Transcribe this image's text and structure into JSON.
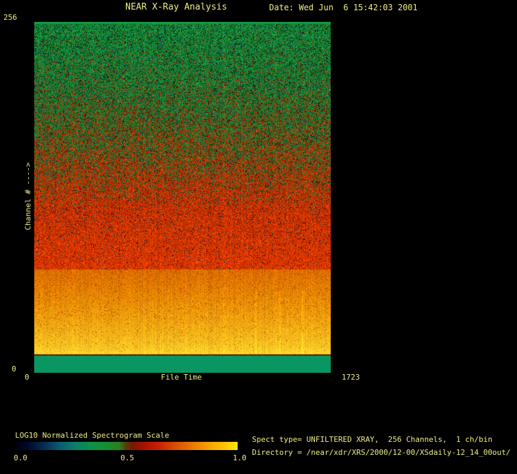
{
  "header": {
    "title": "NEAR X-Ray Analysis",
    "date_label": "Date: Wed Jun  6 15:42:03 2001"
  },
  "axes": {
    "y_max": "256",
    "y_min": "0",
    "y_title": "Channel # ---->",
    "x_min": "0",
    "x_max": "1723",
    "x_title": "File Time"
  },
  "footer": {
    "scale_label": "LOG10 Normalized Spectrogram Scale",
    "scale_tick_left": "0.0",
    "scale_tick_mid": "0.5",
    "scale_tick_right": "1.0",
    "spect_info": "Spect type= UNFILTERED XRAY,  256 Channels,  1 ch/bin",
    "directory_info": "Directory = /near/xdr/XRS/2000/12-00/XSdaily-12_14_00out/"
  },
  "colors": {
    "text": "#f1ee85",
    "background": "#000000",
    "bottom_green": "#0a9663"
  },
  "chart_data": {
    "type": "heatmap",
    "title": "NEAR X-Ray Analysis",
    "xlabel": "File Time",
    "ylabel": "Channel # ---->",
    "x_range": [
      0,
      1723
    ],
    "y_range": [
      0,
      256
    ],
    "x_ticks": [
      "0",
      "1723"
    ],
    "y_ticks": [
      "0",
      "256"
    ],
    "grid": false,
    "colorbar": {
      "label": "LOG10 Normalized Spectrogram Scale",
      "range": [
        0.0,
        1.0
      ],
      "ticks": [
        "0.0",
        "0.5",
        "1.0"
      ],
      "stops": [
        {
          "pos": 0.0,
          "color": "#00000d"
        },
        {
          "pos": 0.06,
          "color": "#000a28"
        },
        {
          "pos": 0.13,
          "color": "#062c52"
        },
        {
          "pos": 0.2,
          "color": "#0b5a74"
        },
        {
          "pos": 0.27,
          "color": "#0c7e6a"
        },
        {
          "pos": 0.34,
          "color": "#0c9148"
        },
        {
          "pos": 0.41,
          "color": "#149032"
        },
        {
          "pos": 0.47,
          "color": "#2e7c1a"
        },
        {
          "pos": 0.5,
          "color": "#553c08"
        },
        {
          "pos": 0.53,
          "color": "#7c1404"
        },
        {
          "pos": 0.58,
          "color": "#a81200"
        },
        {
          "pos": 0.64,
          "color": "#c41e00"
        },
        {
          "pos": 0.72,
          "color": "#d94e00"
        },
        {
          "pos": 0.8,
          "color": "#ea7a00"
        },
        {
          "pos": 0.88,
          "color": "#f8a600"
        },
        {
          "pos": 0.95,
          "color": "#ffc800"
        },
        {
          "pos": 1.0,
          "color": "#ffe800"
        }
      ]
    },
    "bands": [
      {
        "name": "top-edge-line",
        "channels": [
          255,
          256
        ],
        "range": [
          0.0,
          0.005
        ],
        "style": "solid",
        "color": "#129a43",
        "jitter": 0.08,
        "approx_scale_value": 0.42
      },
      {
        "name": "high-channel-noise-green-to-red",
        "channels": [
          80,
          255
        ],
        "range": [
          0.005,
          0.706
        ],
        "style": "green-red-noise",
        "greens": [
          "#128a34",
          "#1f9c3e",
          "#0b7a2c",
          "#27a843",
          "#0e9238",
          "#066f26"
        ],
        "reds": [
          "#a02200",
          "#bf3000",
          "#8c1e00",
          "#d24100",
          "#b02900"
        ],
        "darks": [
          "#000406",
          "#001b38",
          "#034058",
          "#006a82",
          "#08243e",
          "#000000"
        ],
        "approx_scale_value_top": 0.42,
        "approx_scale_value_bottom": 0.62
      },
      {
        "name": "low-channel-orange-band",
        "channels": [
          14,
          80
        ],
        "range": [
          0.706,
          0.947
        ],
        "style": "orange-noise",
        "from": "#dd7200",
        "to": "#ffcc2a",
        "streaks": [
          0.745,
          0.827,
          0.903
        ],
        "approx_scale_value_top": 0.75,
        "approx_scale_value_bottom": 0.92
      },
      {
        "name": "separator-line",
        "channels": [
          13,
          14
        ],
        "range": [
          0.947,
          0.951
        ],
        "style": "separator",
        "color": "#5c2a06",
        "approx_scale_value": 0.52
      },
      {
        "name": "channel-zero-green-block",
        "channels": [
          0,
          13
        ],
        "range": [
          0.951,
          1.0
        ],
        "style": "solid",
        "color": "#0a9663",
        "jitter": 0.0,
        "approx_scale_value": 0.4
      }
    ]
  }
}
